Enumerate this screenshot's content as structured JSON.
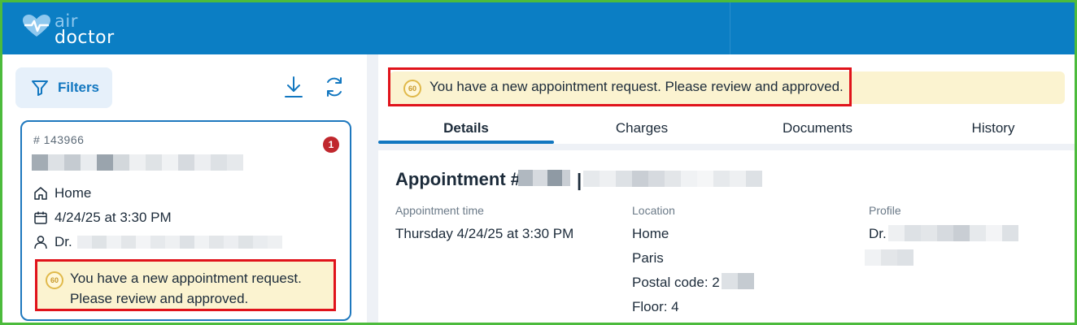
{
  "header": {
    "logo_air": "air",
    "logo_doctor": "doctor"
  },
  "toolbar": {
    "filters_label": "Filters"
  },
  "card": {
    "id": "# 143966",
    "badge_count": "1",
    "location": "Home",
    "datetime": "4/24/25 at 3:30 PM",
    "doctor_prefix": "Dr.",
    "alert_timer": "60",
    "alert_line1": "You have a new appointment request.",
    "alert_line2": "Please review and approved."
  },
  "banner": {
    "timer": "60",
    "text": "You have a new appointment request. Please review and approved."
  },
  "tabs": [
    {
      "label": "Details",
      "active": true
    },
    {
      "label": "Charges",
      "active": false
    },
    {
      "label": "Documents",
      "active": false
    },
    {
      "label": "History",
      "active": false
    }
  ],
  "details": {
    "title_prefix": "Appointment #",
    "title_sep": "|",
    "appointment_time_label": "Appointment time",
    "appointment_time_value": "Thursday 4/24/25 at 3:30 PM",
    "location_label": "Location",
    "location_lines": [
      "Home",
      "Paris",
      "Postal code: 2",
      "Floor: 4"
    ],
    "profile_label": "Profile",
    "profile_prefix": "Dr."
  },
  "colors": {
    "header_bg": "#0b7ec4",
    "accent": "#1277c0",
    "alert_bg": "#fbf3d0",
    "highlight_border": "#e0131b",
    "badge": "#c0272d"
  }
}
